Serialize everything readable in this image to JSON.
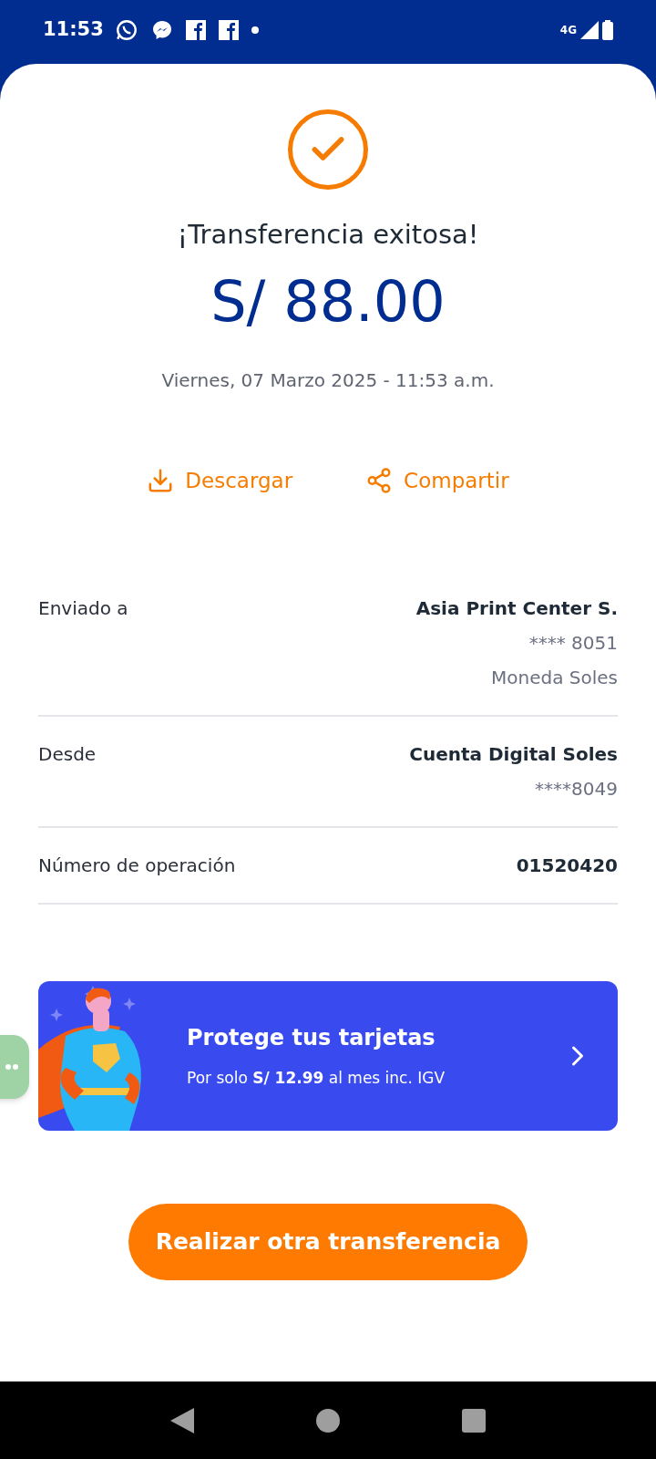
{
  "status_bar": {
    "time": "11:53",
    "network": "4G"
  },
  "title": "¡Transferencia exitosa!",
  "amount": "S/ 88.00",
  "datetime": "Viernes, 07 Marzo 2025 - 11:53 a.m.",
  "actions": [
    {
      "kind": "download",
      "label": "Descargar"
    },
    {
      "kind": "share",
      "label": "Compartir"
    }
  ],
  "details": [
    {
      "label": "Enviado a",
      "lines": [
        {
          "kind": "primary",
          "text": "Asia Print Center S."
        },
        {
          "kind": "secondary",
          "text": "**** 8051"
        },
        {
          "kind": "secondary",
          "text": "Moneda Soles"
        }
      ]
    },
    {
      "label": "Desde",
      "lines": [
        {
          "kind": "primary",
          "text": "Cuenta Digital Soles"
        },
        {
          "kind": "secondary",
          "text": "****8049"
        }
      ]
    },
    {
      "label": "Número de operación",
      "lines": [
        {
          "kind": "primary",
          "text": "01520420"
        }
      ]
    }
  ],
  "promo": {
    "title": "Protege tus tarjetas",
    "subtitle": "Por solo **S/ 12.99** al mes inc. IGV"
  },
  "primary_button": "Realizar otra transferencia"
}
